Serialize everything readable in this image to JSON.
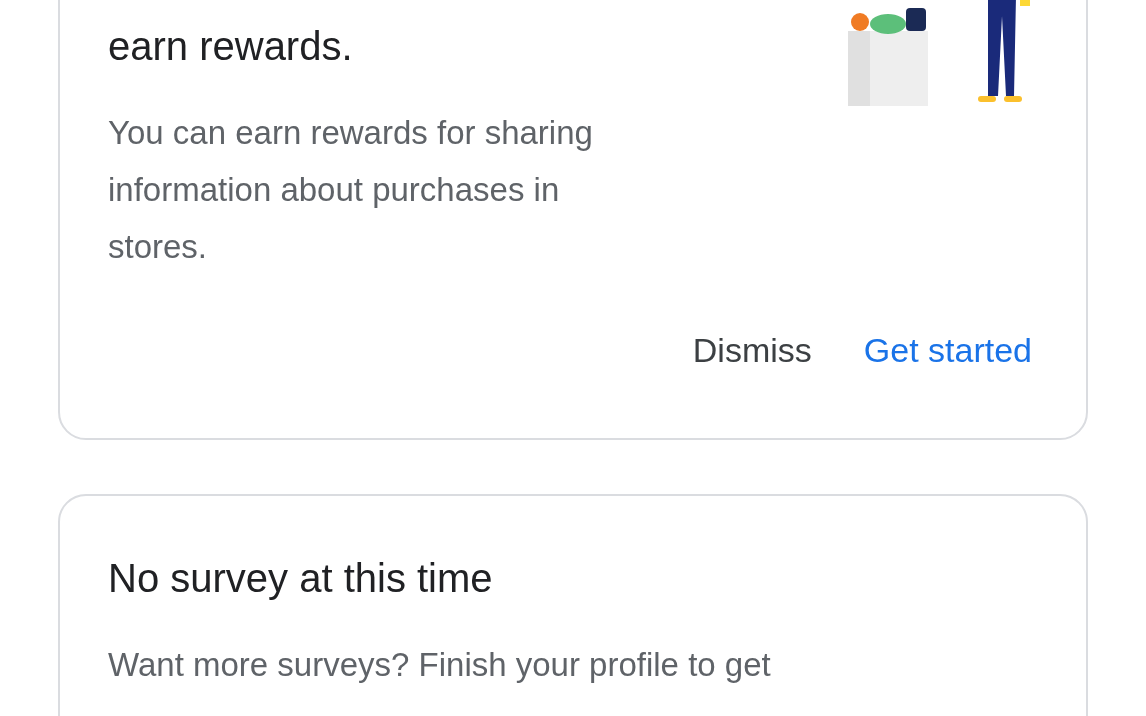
{
  "cards": [
    {
      "title": "earn rewards.",
      "body": "You can earn rewards for sharing information about purchases in stores.",
      "kind": "promo",
      "buttons": [
        {
          "label": "Dismiss",
          "kind": "text"
        },
        {
          "label": "Get started",
          "kind": "primary"
        }
      ]
    },
    {
      "title": "No survey at this time",
      "body": "Want more surveys? Finish your profile to get",
      "kind": "info"
    }
  ]
}
